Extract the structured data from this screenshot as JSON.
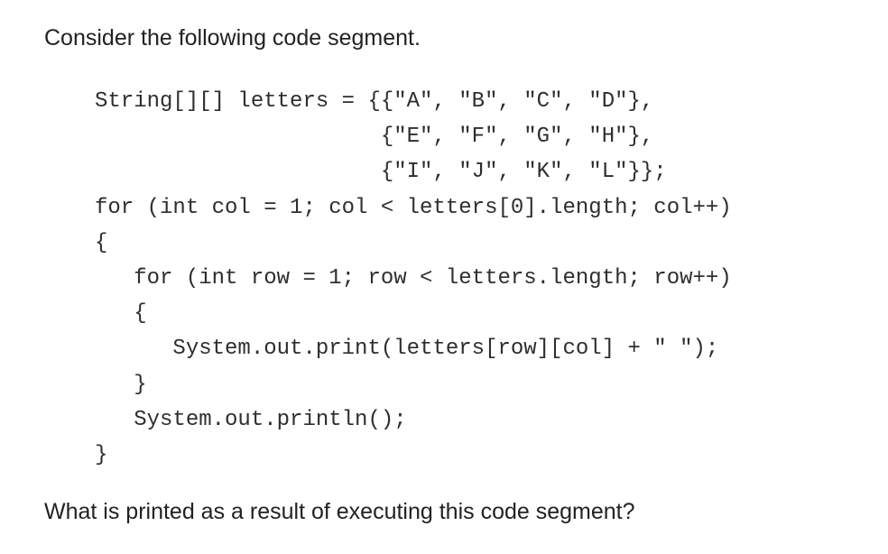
{
  "intro_text": "Consider the following code segment.",
  "code_lines": [
    "String[][] letters = {{\"A\", \"B\", \"C\", \"D\"},",
    "                      {\"E\", \"F\", \"G\", \"H\"},",
    "                      {\"I\", \"J\", \"K\", \"L\"}};",
    "for (int col = 1; col < letters[0].length; col++)",
    "{",
    "   for (int row = 1; row < letters.length; row++)",
    "   {",
    "      System.out.print(letters[row][col] + \" \");",
    "   }",
    "   System.out.println();",
    "}"
  ],
  "question_text": "What is printed as a result of executing this code segment?"
}
